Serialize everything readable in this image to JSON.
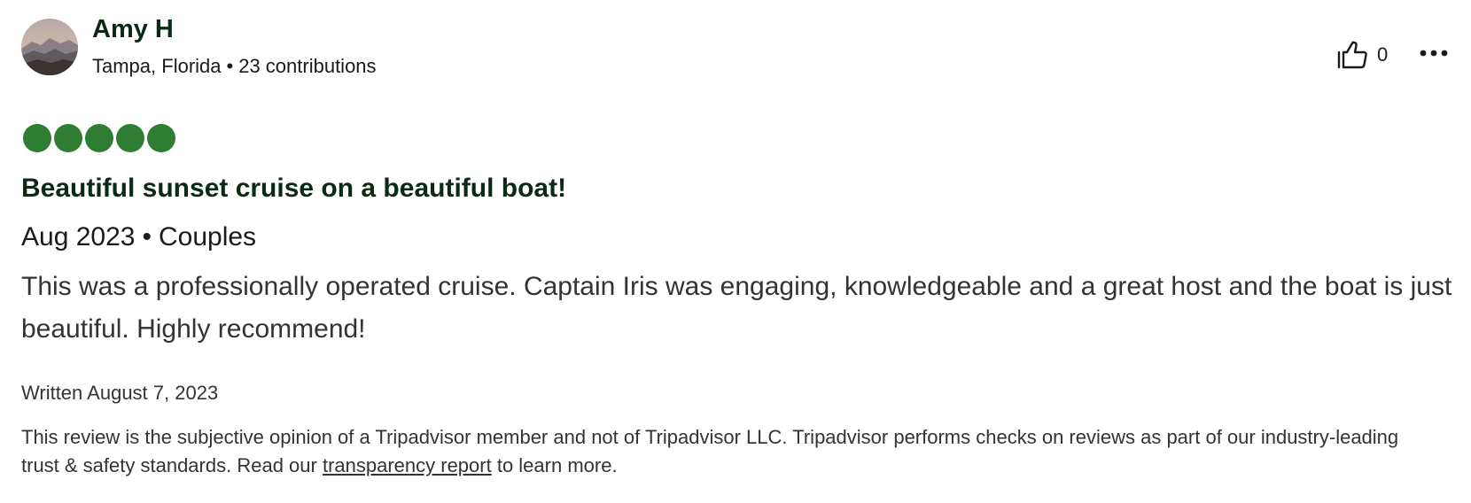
{
  "author": {
    "name": "Amy H",
    "location": "Tampa, Florida",
    "contributions": "23 contributions",
    "separator": "•"
  },
  "actions": {
    "helpful_count": "0",
    "helpful_icon": "thumbs-up-icon",
    "more_icon": "more-options-icon"
  },
  "rating": {
    "value": 5,
    "max": 5,
    "color": "#2e7d32"
  },
  "review": {
    "title": "Beautiful sunset cruise on a beautiful boat!",
    "date": "Aug 2023",
    "separator": "•",
    "trip_type": "Couples",
    "body": "This was a professionally operated cruise. Captain Iris was engaging, knowledgeable and a great host and the boat is just beautiful. Highly recommend!",
    "written": "Written August 7, 2023"
  },
  "disclaimer": {
    "text_before": "This review is the subjective opinion of a Tripadvisor member and not of Tripadvisor LLC. Tripadvisor performs checks on reviews as part of our industry-leading trust & safety standards. Read our ",
    "link": "transparency report",
    "text_after": " to learn more."
  }
}
